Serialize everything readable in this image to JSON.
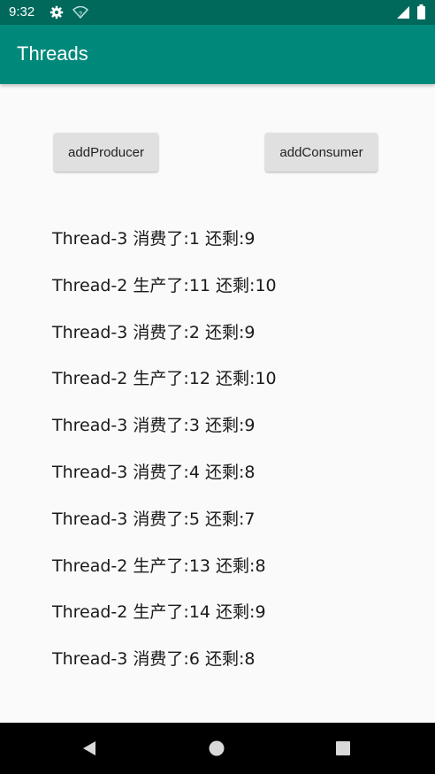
{
  "status_bar": {
    "time": "9:32",
    "icons": [
      "gear-icon",
      "wifi-icon",
      "signal-icon",
      "battery-icon"
    ]
  },
  "app_bar": {
    "title": "Threads",
    "color": "#00897b"
  },
  "buttons": {
    "add_producer": "addProducer",
    "add_consumer": "addConsumer"
  },
  "log": [
    "Thread-3 消费了:1 还剩:9",
    "Thread-2 生产了:11 还剩:10",
    "Thread-3 消费了:2 还剩:9",
    "Thread-2 生产了:12 还剩:10",
    "Thread-3 消费了:3 还剩:9",
    "Thread-3 消费了:4 还剩:8",
    "Thread-3 消费了:5 还剩:7",
    "Thread-2 生产了:13 还剩:8",
    "Thread-2 生产了:14 还剩:9",
    "Thread-3 消费了:6 还剩:8"
  ],
  "nav_bar": {
    "icons": [
      "back-icon",
      "home-icon",
      "recents-icon"
    ]
  }
}
